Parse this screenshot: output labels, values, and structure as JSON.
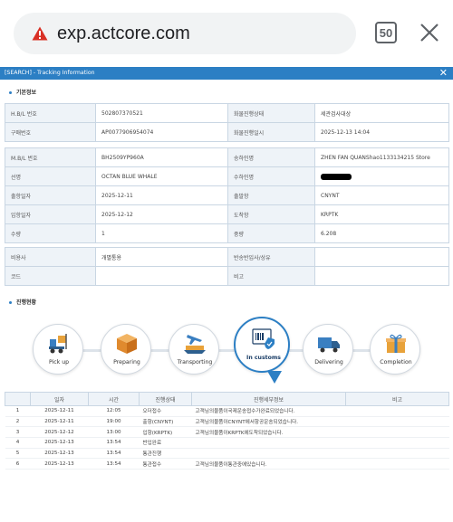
{
  "browser": {
    "url": "exp.actcore.com",
    "tab_count": "50",
    "colors": {
      "warning": "#d93025",
      "accent": "#2c7fc4"
    }
  },
  "popup": {
    "title": "[SEARCH] - Tracking Information",
    "close": "✕"
  },
  "sections": {
    "basic": "기본정보",
    "progress": "진행현황"
  },
  "info1": [
    {
      "l1": "H.B/L 번호",
      "v1": "502807370521",
      "l2": "화물진행상태",
      "v2": "세관검사대상"
    },
    {
      "l1": "구매번호",
      "v1": "AP0077906954074",
      "l2": "화물진행일시",
      "v2": "2025-12-13 14:04"
    }
  ],
  "info2": [
    {
      "l1": "M.B/L 번호",
      "v1": "BH2509YP960A",
      "l2": "송하인명",
      "v2": "ZHEN FAN QUANShao1133134215 Store"
    },
    {
      "l1": "선명",
      "v1": "OCTAN BLUE WHALE",
      "l2": "수하인명",
      "v2": ""
    },
    {
      "l1": "출항일자",
      "v1": "2025-12-11",
      "l2": "출발항",
      "v2": "CNYNT"
    },
    {
      "l1": "입항일자",
      "v1": "2025-12-12",
      "l2": "도착항",
      "v2": "KRPTK"
    },
    {
      "l1": "수량",
      "v1": "1",
      "l2": "중량",
      "v2": "6.208"
    }
  ],
  "info3": [
    {
      "l1": "비용사",
      "v1": "개별통용",
      "l2": "반송반입사/상유",
      "v2": ""
    },
    {
      "l1": "코드",
      "v1": "",
      "l2": "비고",
      "v2": ""
    }
  ],
  "steps": [
    {
      "label": "Pick up",
      "icon": "forklift-icon"
    },
    {
      "label": "Preparing",
      "icon": "box-icon"
    },
    {
      "label": "Transporting",
      "icon": "plane-ship-icon"
    },
    {
      "label": "In customs",
      "icon": "customs-document-icon"
    },
    {
      "label": "Delivering",
      "icon": "truck-icon"
    },
    {
      "label": "Completion",
      "icon": "gift-icon"
    }
  ],
  "active_step": 3,
  "track": {
    "headers": [
      "",
      "일자",
      "시간",
      "진행상태",
      "진행세부정보",
      "비고"
    ],
    "rows": [
      {
        "no": "1",
        "date": "2025-12-11",
        "time": "12:05",
        "status": "오더접수",
        "detail": "고객님의물품이국제운송접수가완료되었습니다.",
        "note": ""
      },
      {
        "no": "2",
        "date": "2025-12-11",
        "time": "19:00",
        "status": "출항(CNYNT)",
        "detail": "고객님의물품이CNYNT에서항공운송되었습니다.",
        "note": ""
      },
      {
        "no": "3",
        "date": "2025-12-12",
        "time": "13:00",
        "status": "입항(KRPTK)",
        "detail": "고객님의물품이KRPTK에도착되었습니다.",
        "note": ""
      },
      {
        "no": "4",
        "date": "2025-12-13",
        "time": "13:54",
        "status": "반입완료",
        "detail": "",
        "note": ""
      },
      {
        "no": "5",
        "date": "2025-12-13",
        "time": "13:54",
        "status": "통관진행",
        "detail": "",
        "note": ""
      },
      {
        "no": "6",
        "date": "2025-12-13",
        "time": "13:54",
        "status": "통관접수",
        "detail": "고객님의물품이통관중에있습니다.",
        "note": ""
      }
    ]
  }
}
